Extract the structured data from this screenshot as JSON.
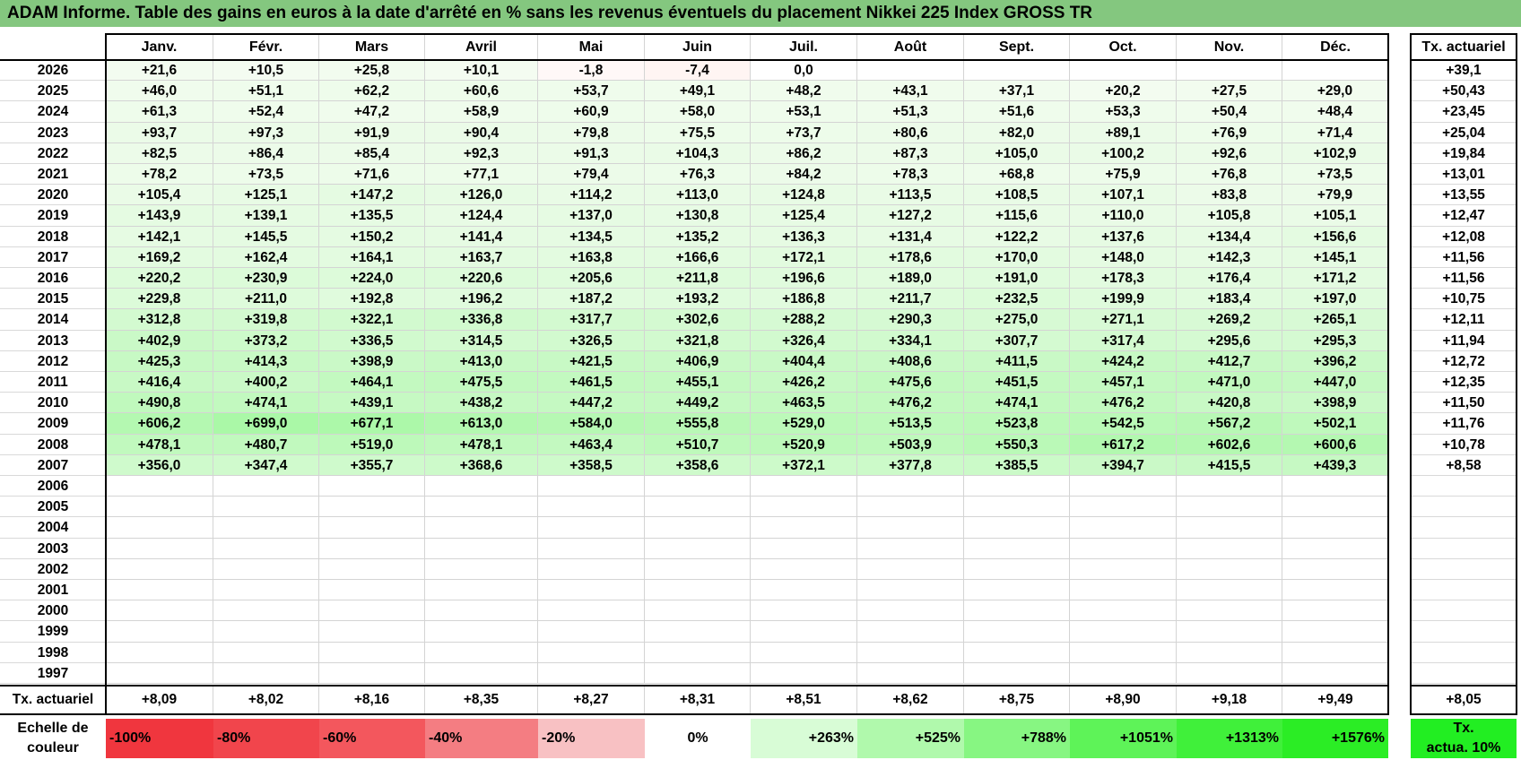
{
  "title": "ADAM Informe. Table des gains en euros à la date d'arrêté en % sans les revenus éventuels du placement Nikkei 225 Index GROSS TR",
  "months": [
    "Janv.",
    "Févr.",
    "Mars",
    "Avril",
    "Mai",
    "Juin",
    "Juil.",
    "Août",
    "Sept.",
    "Oct.",
    "Nov.",
    "Déc."
  ],
  "right_header": "Tx. actuariel",
  "rows": [
    {
      "year": "2026",
      "values": [
        "+21,6",
        "+10,5",
        "+25,8",
        "+10,1",
        "-1,8",
        "-7,4",
        "0,0",
        "",
        "",
        "",
        "",
        ""
      ],
      "tx": "+39,1"
    },
    {
      "year": "2025",
      "values": [
        "+46,0",
        "+51,1",
        "+62,2",
        "+60,6",
        "+53,7",
        "+49,1",
        "+48,2",
        "+43,1",
        "+37,1",
        "+20,2",
        "+27,5",
        "+29,0"
      ],
      "tx": "+50,43"
    },
    {
      "year": "2024",
      "values": [
        "+61,3",
        "+52,4",
        "+47,2",
        "+58,9",
        "+60,9",
        "+58,0",
        "+53,1",
        "+51,3",
        "+51,6",
        "+53,3",
        "+50,4",
        "+48,4"
      ],
      "tx": "+23,45"
    },
    {
      "year": "2023",
      "values": [
        "+93,7",
        "+97,3",
        "+91,9",
        "+90,4",
        "+79,8",
        "+75,5",
        "+73,7",
        "+80,6",
        "+82,0",
        "+89,1",
        "+76,9",
        "+71,4"
      ],
      "tx": "+25,04"
    },
    {
      "year": "2022",
      "values": [
        "+82,5",
        "+86,4",
        "+85,4",
        "+92,3",
        "+91,3",
        "+104,3",
        "+86,2",
        "+87,3",
        "+105,0",
        "+100,2",
        "+92,6",
        "+102,9"
      ],
      "tx": "+19,84"
    },
    {
      "year": "2021",
      "values": [
        "+78,2",
        "+73,5",
        "+71,6",
        "+77,1",
        "+79,4",
        "+76,3",
        "+84,2",
        "+78,3",
        "+68,8",
        "+75,9",
        "+76,8",
        "+73,5"
      ],
      "tx": "+13,01"
    },
    {
      "year": "2020",
      "values": [
        "+105,4",
        "+125,1",
        "+147,2",
        "+126,0",
        "+114,2",
        "+113,0",
        "+124,8",
        "+113,5",
        "+108,5",
        "+107,1",
        "+83,8",
        "+79,9"
      ],
      "tx": "+13,55"
    },
    {
      "year": "2019",
      "values": [
        "+143,9",
        "+139,1",
        "+135,5",
        "+124,4",
        "+137,0",
        "+130,8",
        "+125,4",
        "+127,2",
        "+115,6",
        "+110,0",
        "+105,8",
        "+105,1"
      ],
      "tx": "+12,47"
    },
    {
      "year": "2018",
      "values": [
        "+142,1",
        "+145,5",
        "+150,2",
        "+141,4",
        "+134,5",
        "+135,2",
        "+136,3",
        "+131,4",
        "+122,2",
        "+137,6",
        "+134,4",
        "+156,6"
      ],
      "tx": "+12,08"
    },
    {
      "year": "2017",
      "values": [
        "+169,2",
        "+162,4",
        "+164,1",
        "+163,7",
        "+163,8",
        "+166,6",
        "+172,1",
        "+178,6",
        "+170,0",
        "+148,0",
        "+142,3",
        "+145,1"
      ],
      "tx": "+11,56"
    },
    {
      "year": "2016",
      "values": [
        "+220,2",
        "+230,9",
        "+224,0",
        "+220,6",
        "+205,6",
        "+211,8",
        "+196,6",
        "+189,0",
        "+191,0",
        "+178,3",
        "+176,4",
        "+171,2"
      ],
      "tx": "+11,56"
    },
    {
      "year": "2015",
      "values": [
        "+229,8",
        "+211,0",
        "+192,8",
        "+196,2",
        "+187,2",
        "+193,2",
        "+186,8",
        "+211,7",
        "+232,5",
        "+199,9",
        "+183,4",
        "+197,0"
      ],
      "tx": "+10,75"
    },
    {
      "year": "2014",
      "values": [
        "+312,8",
        "+319,8",
        "+322,1",
        "+336,8",
        "+317,7",
        "+302,6",
        "+288,2",
        "+290,3",
        "+275,0",
        "+271,1",
        "+269,2",
        "+265,1"
      ],
      "tx": "+12,11"
    },
    {
      "year": "2013",
      "values": [
        "+402,9",
        "+373,2",
        "+336,5",
        "+314,5",
        "+326,5",
        "+321,8",
        "+326,4",
        "+334,1",
        "+307,7",
        "+317,4",
        "+295,6",
        "+295,3"
      ],
      "tx": "+11,94"
    },
    {
      "year": "2012",
      "values": [
        "+425,3",
        "+414,3",
        "+398,9",
        "+413,0",
        "+421,5",
        "+406,9",
        "+404,4",
        "+408,6",
        "+411,5",
        "+424,2",
        "+412,7",
        "+396,2"
      ],
      "tx": "+12,72"
    },
    {
      "year": "2011",
      "values": [
        "+416,4",
        "+400,2",
        "+464,1",
        "+475,5",
        "+461,5",
        "+455,1",
        "+426,2",
        "+475,6",
        "+451,5",
        "+457,1",
        "+471,0",
        "+447,0"
      ],
      "tx": "+12,35"
    },
    {
      "year": "2010",
      "values": [
        "+490,8",
        "+474,1",
        "+439,1",
        "+438,2",
        "+447,2",
        "+449,2",
        "+463,5",
        "+476,2",
        "+474,1",
        "+476,2",
        "+420,8",
        "+398,9"
      ],
      "tx": "+11,50"
    },
    {
      "year": "2009",
      "values": [
        "+606,2",
        "+699,0",
        "+677,1",
        "+613,0",
        "+584,0",
        "+555,8",
        "+529,0",
        "+513,5",
        "+523,8",
        "+542,5",
        "+567,2",
        "+502,1"
      ],
      "tx": "+11,76"
    },
    {
      "year": "2008",
      "values": [
        "+478,1",
        "+480,7",
        "+519,0",
        "+478,1",
        "+463,4",
        "+510,7",
        "+520,9",
        "+503,9",
        "+550,3",
        "+617,2",
        "+602,6",
        "+600,6"
      ],
      "tx": "+10,78"
    },
    {
      "year": "2007",
      "values": [
        "+356,0",
        "+347,4",
        "+355,7",
        "+368,6",
        "+358,5",
        "+358,6",
        "+372,1",
        "+377,8",
        "+385,5",
        "+394,7",
        "+415,5",
        "+439,3"
      ],
      "tx": "+8,58"
    },
    {
      "year": "2006",
      "values": [
        "",
        "",
        "",
        "",
        "",
        "",
        "",
        "",
        "",
        "",
        "",
        ""
      ],
      "tx": ""
    },
    {
      "year": "2005",
      "values": [
        "",
        "",
        "",
        "",
        "",
        "",
        "",
        "",
        "",
        "",
        "",
        ""
      ],
      "tx": ""
    },
    {
      "year": "2004",
      "values": [
        "",
        "",
        "",
        "",
        "",
        "",
        "",
        "",
        "",
        "",
        "",
        ""
      ],
      "tx": ""
    },
    {
      "year": "2003",
      "values": [
        "",
        "",
        "",
        "",
        "",
        "",
        "",
        "",
        "",
        "",
        "",
        ""
      ],
      "tx": ""
    },
    {
      "year": "2002",
      "values": [
        "",
        "",
        "",
        "",
        "",
        "",
        "",
        "",
        "",
        "",
        "",
        ""
      ],
      "tx": ""
    },
    {
      "year": "2001",
      "values": [
        "",
        "",
        "",
        "",
        "",
        "",
        "",
        "",
        "",
        "",
        "",
        ""
      ],
      "tx": ""
    },
    {
      "year": "2000",
      "values": [
        "",
        "",
        "",
        "",
        "",
        "",
        "",
        "",
        "",
        "",
        "",
        ""
      ],
      "tx": ""
    },
    {
      "year": "1999",
      "values": [
        "",
        "",
        "",
        "",
        "",
        "",
        "",
        "",
        "",
        "",
        "",
        ""
      ],
      "tx": ""
    },
    {
      "year": "1998",
      "values": [
        "",
        "",
        "",
        "",
        "",
        "",
        "",
        "",
        "",
        "",
        "",
        ""
      ],
      "tx": ""
    },
    {
      "year": "1997",
      "values": [
        "",
        "",
        "",
        "",
        "",
        "",
        "",
        "",
        "",
        "",
        "",
        ""
      ],
      "tx": ""
    }
  ],
  "footer": {
    "label": "Tx. actuariel",
    "values": [
      "+8,09",
      "+8,02",
      "+8,16",
      "+8,35",
      "+8,27",
      "+8,31",
      "+8,51",
      "+8,62",
      "+8,75",
      "+8,90",
      "+9,18",
      "+9,49"
    ],
    "tx": "+8,05"
  },
  "scale": {
    "label_line1": "Echelle de",
    "label_line2": "couleur",
    "items": [
      {
        "text": "-100%",
        "color": "#f0363e"
      },
      {
        "text": "-80%",
        "color": "#f1454c"
      },
      {
        "text": "-60%",
        "color": "#f3575d"
      },
      {
        "text": "-40%",
        "color": "#f47d82"
      },
      {
        "text": "-20%",
        "color": "#f8c1c3"
      },
      {
        "text": "0%",
        "color": "#ffffff"
      },
      {
        "text": "+263%",
        "color": "#d8fcd6"
      },
      {
        "text": "+525%",
        "color": "#b0f9ac"
      },
      {
        "text": "+788%",
        "color": "#87f682"
      },
      {
        "text": "+1051%",
        "color": "#5ef358"
      },
      {
        "text": "+1313%",
        "color": "#40f03a"
      },
      {
        "text": "+1576%",
        "color": "#2bed25"
      }
    ],
    "tx_line1": "Tx.",
    "tx_line2": "actua. 10%",
    "tx_color": "#22ee22"
  }
}
